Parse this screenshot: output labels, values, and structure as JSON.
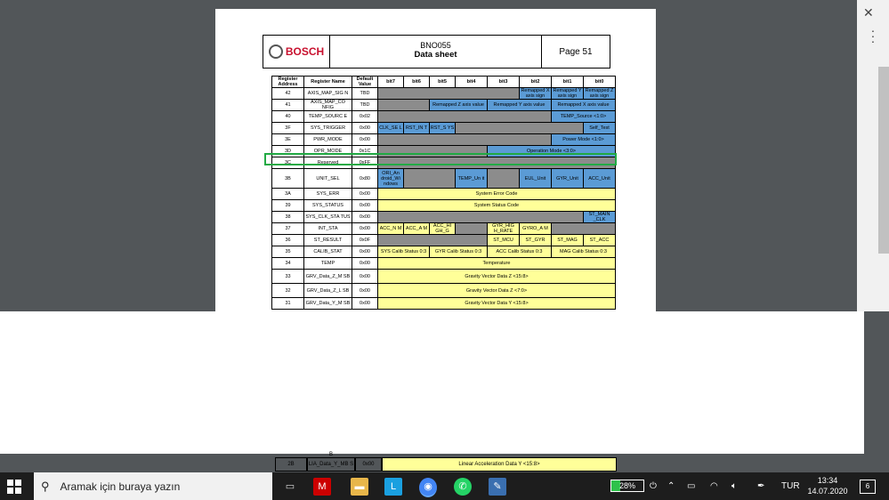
{
  "doc": {
    "brand": "BOSCH",
    "product": "BNO055",
    "subtitle": "Data sheet",
    "page": "Page 51"
  },
  "table": {
    "headers": [
      "Register Address",
      "Register Name",
      "Default Value",
      "bit7",
      "bit6",
      "bit5",
      "bit4",
      "bit3",
      "bit2",
      "bit1",
      "bit0"
    ],
    "rows": [
      {
        "addr": "42",
        "name": "AXIS_MAP_SIG N",
        "def": "TBD"
      },
      {
        "addr": "41",
        "name": "AXIS_MAP_CO NFIG",
        "def": "TBD"
      },
      {
        "addr": "40",
        "name": "TEMP_SOURC E",
        "def": "0x02"
      },
      {
        "addr": "3F",
        "name": "SYS_TRIGGER",
        "def": "0x00"
      },
      {
        "addr": "3E",
        "name": "PWR_MODE",
        "def": "0x00"
      },
      {
        "addr": "3D",
        "name": "OPR_MODE",
        "def": "0x1C"
      },
      {
        "addr": "3C",
        "name": "Reserved",
        "def": "0xFF"
      },
      {
        "addr": "3B",
        "name": "UNIT_SEL",
        "def": "0x80"
      },
      {
        "addr": "3A",
        "name": "SYS_ERR",
        "def": "0x00"
      },
      {
        "addr": "39",
        "name": "SYS_STATUS",
        "def": "0x00"
      },
      {
        "addr": "38",
        "name": "SYS_CLK_STA TUS",
        "def": "0x00"
      },
      {
        "addr": "37",
        "name": "INT_STA",
        "def": "0x00"
      },
      {
        "addr": "36",
        "name": "ST_RESULT",
        "def": "0x0F"
      },
      {
        "addr": "35",
        "name": "CALIB_STAT",
        "def": "0x00"
      },
      {
        "addr": "34",
        "name": "TEMP",
        "def": "0x00"
      },
      {
        "addr": "33",
        "name": "GRV_Data_Z_M SB",
        "def": "0x00"
      },
      {
        "addr": "32",
        "name": "GRV_Data_Z_L SB",
        "def": "0x00"
      },
      {
        "addr": "31",
        "name": "GRV_Data_Y_M SB",
        "def": "0x00"
      }
    ],
    "cells": {
      "r42": [
        "Remapped X axis sign",
        "Remapped Y axis sign",
        "Remapped Z axis sign"
      ],
      "r41": [
        "Remapped Z axis value",
        "Remapped Y axis value",
        "Remapped X axis value"
      ],
      "r40": "TEMP_Source <1:0>",
      "r3f": [
        "CLK_SE L",
        "RST_IN T",
        "RST_S YS",
        "Self_Test"
      ],
      "r3e": "Power Mode <1:0>",
      "r3d": "Operation Mode <3:0>",
      "r3b": [
        "ORI_An droid_Wi ndows",
        "TEMP_Un it",
        "EUL_Unit",
        "GYR_Unit",
        "ACC_Unit"
      ],
      "r3a": "System Error Code",
      "r39": "System Status Code",
      "r38": "ST_MAIN _CLK",
      "r37": [
        "ACC_N M",
        "ACC_A M",
        "ACC_HI GH_G",
        "GYR_HIG H_RATE",
        "GYRO_A M"
      ],
      "r36": [
        "ST_MCU",
        "ST_GYR",
        "ST_MAG",
        "ST_ACC"
      ],
      "r35": [
        "SYS Calib Status 0:3",
        "GYR Calib Status 0:3",
        "ACC Calib Status 0:3",
        "MAG Calib Status 0:3"
      ],
      "r34": "Temperature",
      "r33": "Gravity Vector Data Z <15:8>",
      "r32": "Gravity Vector Data Z <7:0>",
      "r31": "Gravity Vector Data Y <15:8>"
    },
    "bottom": {
      "partial_name": "B",
      "addr": "2B",
      "name": "LIA_Data_Y_MB S",
      "def": "0x00",
      "desc": "Linear Acceleration Data Y <15:8>"
    }
  },
  "taskbar": {
    "search_placeholder": "Aramak için buraya yazın",
    "battery": "28%",
    "language": "TUR",
    "time": "13:34",
    "date": "14.07.2020",
    "notifications": "6"
  },
  "colors": {
    "yellow": "#ffff99",
    "gray": "#8c8c8c",
    "blue": "#5b9bd5",
    "highlight": "#22aa44"
  }
}
